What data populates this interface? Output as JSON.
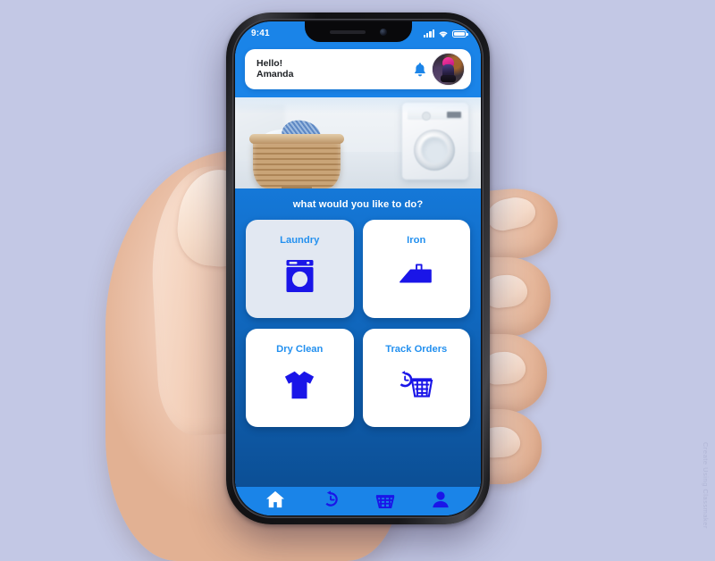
{
  "background_color": "#c3c8e5",
  "phone": {
    "status_bar": {
      "time": "9:41",
      "signal_icon": "cellular-signal-icon",
      "wifi_icon": "wifi-icon",
      "battery_icon": "battery-full-icon"
    },
    "notch": {
      "speaker_icon": "earpiece-speaker-icon",
      "camera_icon": "front-camera-icon"
    }
  },
  "app": {
    "accent_blue": "#1a84e8",
    "icon_blue": "#1a15e8",
    "label_blue": "#2390ef",
    "header": {
      "greeting": "Hello!",
      "user_name": "Amanda",
      "bell_icon": "notification-bell-icon",
      "avatar_icon": "user-avatar-photo"
    },
    "hero": {
      "image_name": "laundry-basket-photo",
      "alt": "Basket of blue laundry in front of a washing machine"
    },
    "prompt": "what would you like to do?",
    "tiles": [
      {
        "label": "Laundry",
        "icon": "washing-machine-icon",
        "style": "light"
      },
      {
        "label": "Iron",
        "icon": "iron-icon",
        "style": "white"
      },
      {
        "label": "Dry Clean",
        "icon": "tshirt-icon",
        "style": "white"
      },
      {
        "label": "Track Orders",
        "icon": "basket-clock-icon",
        "style": "white"
      }
    ],
    "nav": [
      {
        "label": "Home",
        "icon": "home-icon",
        "active": true
      },
      {
        "label": "History",
        "icon": "history-icon",
        "active": false
      },
      {
        "label": "Basket",
        "icon": "basket-icon",
        "active": false
      },
      {
        "label": "Profile",
        "icon": "person-icon",
        "active": false
      }
    ]
  },
  "watermark": "Create Using Classmaker"
}
